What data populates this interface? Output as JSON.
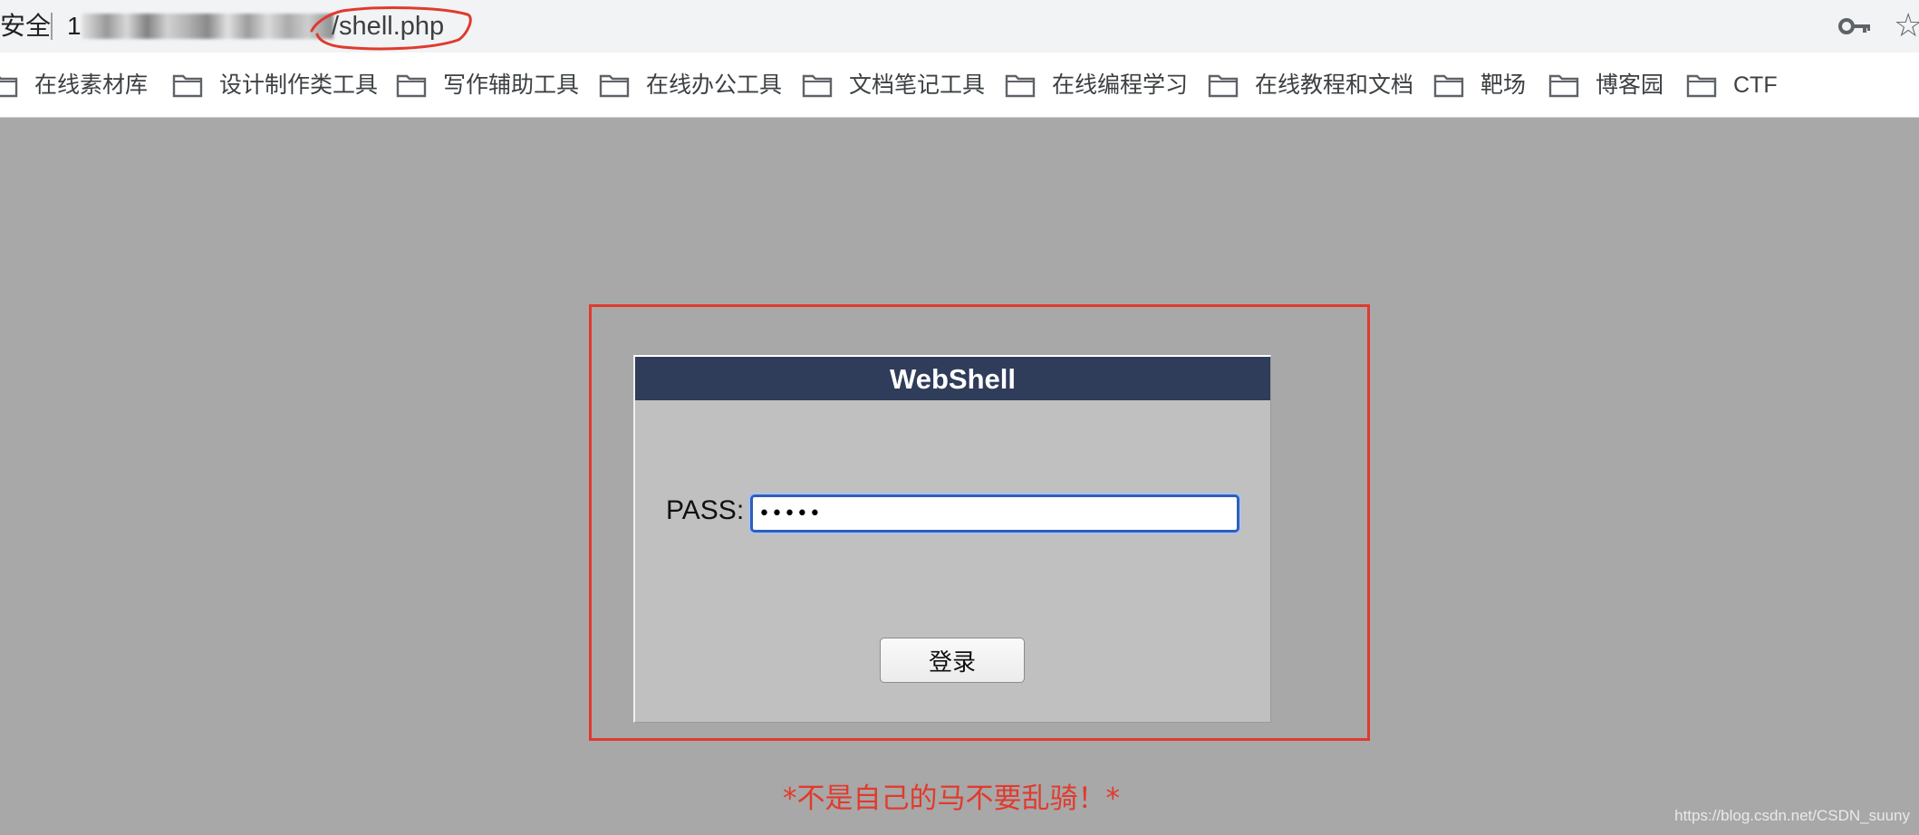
{
  "address_bar": {
    "security_label": "安全",
    "url_start": "1",
    "url_path": "/shell.php"
  },
  "icons": {
    "key": "key-icon",
    "star": "star-outline-icon",
    "folder": "folder-icon"
  },
  "bookmarks": [
    {
      "label": "在线素材库"
    },
    {
      "label": "设计制作类工具"
    },
    {
      "label": "写作辅助工具"
    },
    {
      "label": "在线办公工具"
    },
    {
      "label": "文档笔记工具"
    },
    {
      "label": "在线编程学习"
    },
    {
      "label": "在线教程和文档"
    },
    {
      "label": "靶场"
    },
    {
      "label": "博客园"
    },
    {
      "label": "CTF"
    }
  ],
  "panel": {
    "title": "WebShell",
    "pass_label": "PASS:",
    "pass_value": "•••••",
    "login_label": "登录"
  },
  "warning_text": "*不是自己的马不要乱骑！*",
  "watermark": "https://blog.csdn.net/CSDN_suuny",
  "colors": {
    "page_bg": "#a8a8a8",
    "panel_bg": "#c0c0c0",
    "title_bar": "#2f3c5a",
    "annotation_red": "#e03a2e",
    "warning_red": "#e23a2d",
    "input_focus": "#2f5fb9"
  }
}
